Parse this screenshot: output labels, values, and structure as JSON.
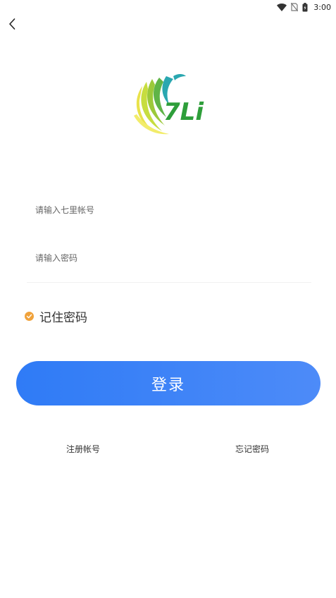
{
  "status_bar": {
    "time": "3:00",
    "icons": [
      "wifi-icon",
      "no-sim-icon",
      "battery-icon"
    ]
  },
  "header": {
    "back_icon": "chevron-left-icon"
  },
  "logo": {
    "text": "7Li",
    "colors": {
      "green": "#2e9e3a",
      "teal": "#2aa7b0",
      "lime": "#9cc93a",
      "yellow": "#e9e24a"
    }
  },
  "form": {
    "account_placeholder": "请输入七里帐号",
    "account_value": "",
    "password_placeholder": "请输入密码",
    "password_value": "",
    "remember_label": "记住密码",
    "remember_checked": true,
    "login_label": "登录"
  },
  "links": {
    "register": "注册帐号",
    "forgot": "忘记密码"
  },
  "colors": {
    "primary": "#2f7bf6",
    "checkbox": "#f0a23b"
  }
}
